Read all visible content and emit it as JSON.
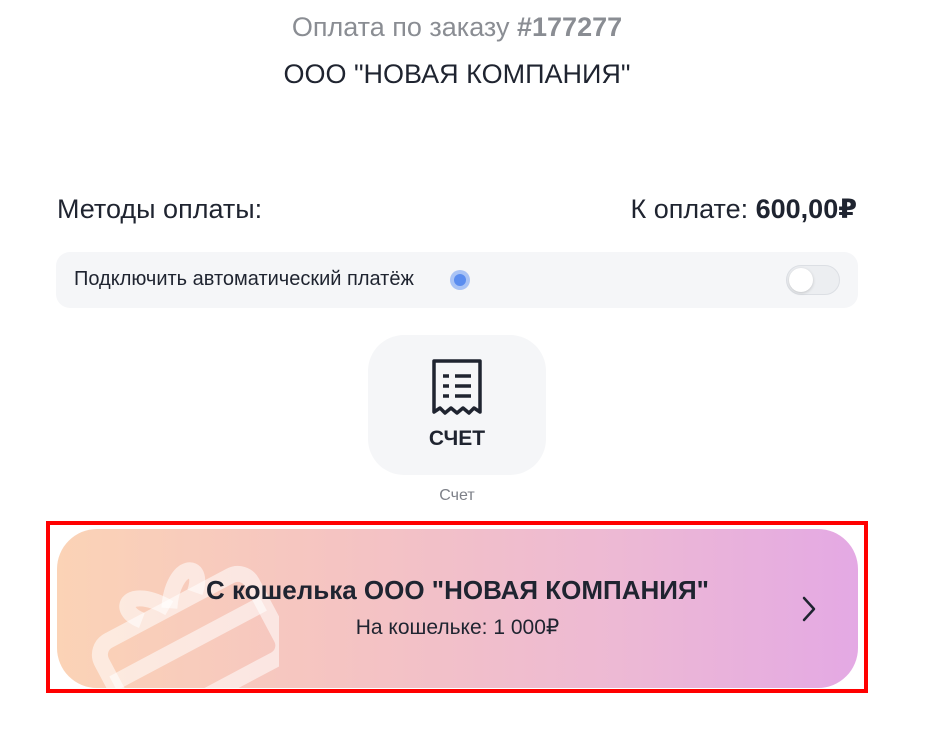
{
  "order": {
    "title_prefix": "Оплата по заказу ",
    "number": "#177277",
    "company": "ООО \"НОВАЯ КОМПАНИЯ\""
  },
  "payment": {
    "methods_label": "Методы оплаты:",
    "amount_label": "К оплате: ",
    "amount_value": "600,00₽"
  },
  "autopay": {
    "label": "Подключить автоматический платёж",
    "enabled": false,
    "info_icon": "info-dot-icon"
  },
  "methods": [
    {
      "icon": "receipt-icon",
      "label": "СЧЕТ",
      "caption": "Счет"
    }
  ],
  "wallet": {
    "title": "С кошелька ООО \"НОВАЯ КОМПАНИЯ\"",
    "balance": "На кошельке: 1 000₽",
    "icon": "gift-icon",
    "arrow_icon": "chevron-right-icon"
  },
  "colors": {
    "highlight_border": "#ff0000",
    "wallet_gradient_start": "#fbd3b6",
    "wallet_gradient_end": "#e4a9e4",
    "info_dot": "#5b8def"
  }
}
